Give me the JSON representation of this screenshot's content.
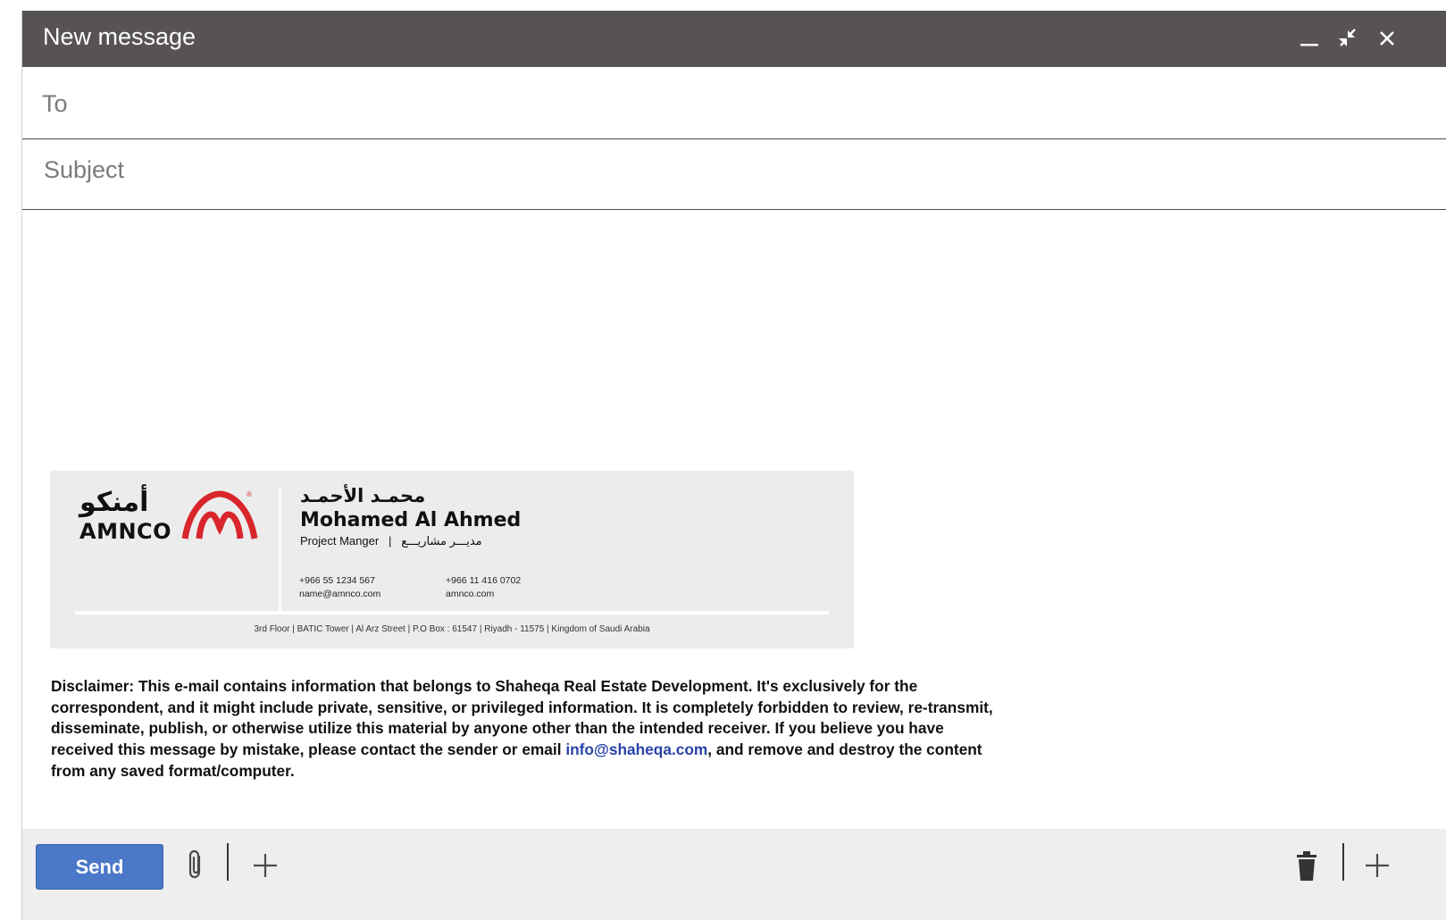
{
  "window": {
    "title": "New message",
    "controls": {
      "minimize_icon": "minimize-icon",
      "exit_fullscreen_icon": "exit-fullscreen-icon",
      "close_icon": "close-icon"
    }
  },
  "fields": {
    "to_label": "To",
    "subject_label": "Subject"
  },
  "signature": {
    "logo_ar": "أمنكو",
    "logo_en": "AMNCO",
    "logo_reg": "®",
    "name_ar": "محمـد الأحمـد",
    "name_en": "Mohamed Al Ahmed",
    "role_en": "Project Manger",
    "role_sep": "|",
    "role_ar": "مديـــر مشاريـــع",
    "mobile": "+966 55 1234 567",
    "email": "name@amnco.com",
    "phone": "+966 11 416 0702",
    "website": "amnco.com",
    "address": "3rd Floor | BATIC Tower | Al Arz Street | P.O Box : 61547 | Riyadh - 11575 | Kingdom of Saudi Arabia"
  },
  "disclaimer": {
    "text_before": "Disclaimer: This e-mail contains information that belongs to Shaheqa Real Estate Development. It's exclusively for the correspondent, and it might include private, sensitive, or privileged information. It is completely forbidden to review, re-transmit, disseminate, publish, or otherwise utilize this material by anyone other than the intended receiver. If you believe you have received this message by mistake, please contact the sender or email ",
    "link": "info@shaheqa.com",
    "text_after": ", and remove and destroy the content from any saved format/computer."
  },
  "toolbar": {
    "send_label": "Send",
    "attach_icon": "paperclip-icon",
    "more_icon": "plus-icon",
    "delete_icon": "trash-icon",
    "more_right_icon": "plus-icon"
  },
  "colors": {
    "titlebar": "#575352",
    "send_button": "#4b78c8",
    "link": "#2a43a8",
    "logo_red": "#d9262b",
    "signature_bg": "#ececec"
  }
}
